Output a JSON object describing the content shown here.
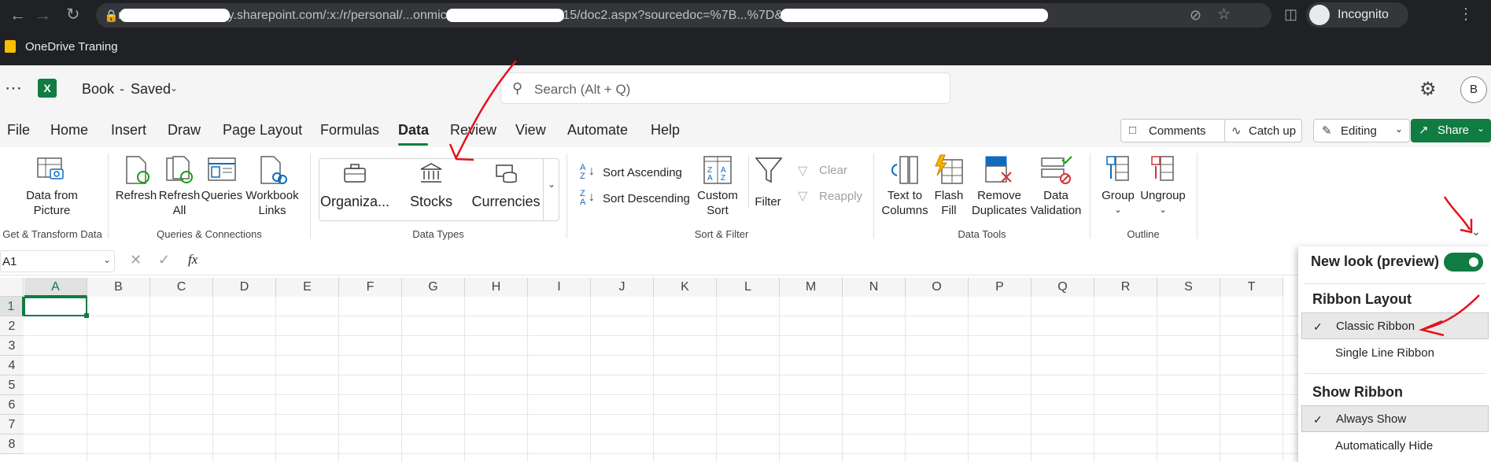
{
  "browser": {
    "url": "m6556ad5077FF my.sharepoint.com/:x:/r/personal/...onmicrosoft_com/_layouts/15/doc2.aspx?sourcedoc=%7B...%7D&...",
    "profile_label": "Incognito",
    "bookmark_label": "OneDrive Traning"
  },
  "app": {
    "doc_title": "Book",
    "doc_status": "Saved",
    "search_placeholder": "Search (Alt + Q)",
    "avatar_initial": "B"
  },
  "menu_tabs": [
    "File",
    "Home",
    "Insert",
    "Draw",
    "Page Layout",
    "Formulas",
    "Data",
    "Review",
    "View",
    "Automate",
    "Help"
  ],
  "active_tab": "Data",
  "top_buttons": {
    "comments": "Comments",
    "catch_up": "Catch up",
    "editing": "Editing",
    "share": "Share"
  },
  "ribbon": {
    "data_from_picture": [
      "Data from",
      "Picture"
    ],
    "refresh": "Refresh",
    "refresh_all": [
      "Refresh",
      "All"
    ],
    "queries": "Queries",
    "workbook_links": [
      "Workbook",
      "Links"
    ],
    "organiza": "Organiza...",
    "stocks": "Stocks",
    "currencies": "Currencies",
    "sort_ascending": "Sort Ascending",
    "sort_descending": "Sort Descending",
    "custom_sort": [
      "Custom",
      "Sort"
    ],
    "filter": "Filter",
    "clear": "Clear",
    "reapply": "Reapply",
    "text_to_columns": [
      "Text to",
      "Columns"
    ],
    "flash_fill": [
      "Flash",
      "Fill"
    ],
    "remove_duplicates": [
      "Remove",
      "Duplicates"
    ],
    "data_validation": [
      "Data",
      "Validation"
    ],
    "group": "Group",
    "ungroup": "Ungroup",
    "groups": {
      "get_transform": "Get & Transform Data",
      "queries_connections": "Queries & Connections",
      "data_types": "Data Types",
      "sort_filter": "Sort & Filter",
      "data_tools": "Data Tools",
      "outline": "Outline"
    }
  },
  "formula_bar": {
    "name_box": "A1",
    "fx": "fx"
  },
  "grid": {
    "columns": [
      "A",
      "B",
      "C",
      "D",
      "E",
      "F",
      "G",
      "H",
      "I",
      "J",
      "K",
      "L",
      "M",
      "N",
      "O",
      "P",
      "Q",
      "R",
      "S",
      "T"
    ],
    "rows": [
      "1",
      "2",
      "3",
      "4",
      "5",
      "6",
      "7",
      "8"
    ]
  },
  "panel": {
    "new_look": "New look (preview)",
    "ribbon_layout_heading": "Ribbon Layout",
    "classic_ribbon": "Classic Ribbon",
    "single_line_ribbon": "Single Line Ribbon",
    "show_ribbon_heading": "Show Ribbon",
    "always_show": "Always Show",
    "automatically_hide": "Automatically Hide"
  },
  "colors": {
    "excel_green": "#107c41",
    "annotation_red": "#e3121b",
    "chrome_dark": "#202124"
  }
}
